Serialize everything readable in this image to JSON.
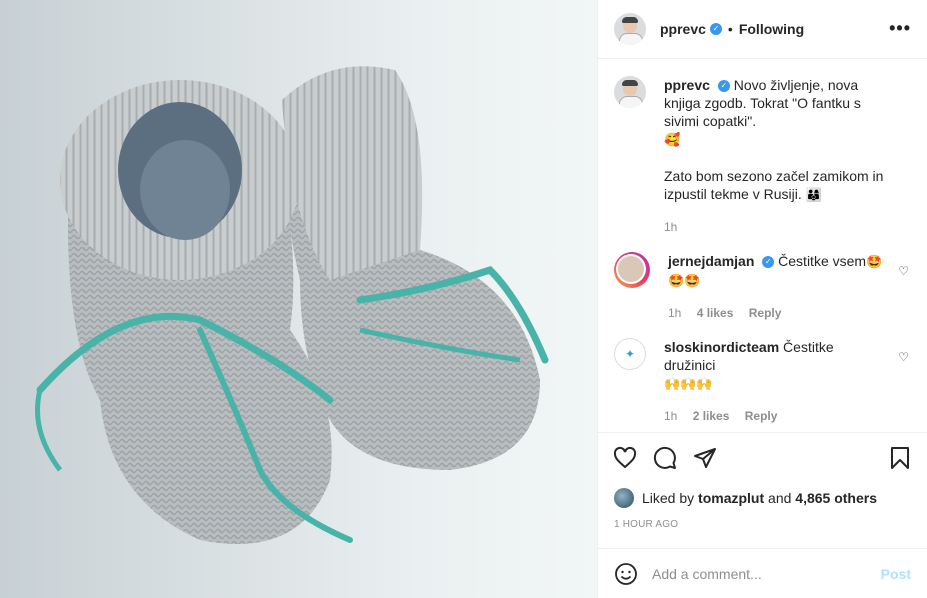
{
  "header": {
    "username": "pprevc",
    "separator": "•",
    "follow_state": "Following",
    "more_label": "•••"
  },
  "caption": {
    "username": "pprevc",
    "text_line1": "Novo življenje, nova knjiga zgodb. Tokrat \"O fantku s sivimi copatki\".",
    "emoji1": "🥰",
    "text_line2": "Zato bom sezono začel zamikom in izpustil tekme v Rusiji.",
    "emoji2": "👨‍👩‍👦",
    "time": "1h"
  },
  "comments": [
    {
      "username": "jernejdamjan",
      "text": "Čestitke vsem",
      "emoji": "🤩",
      "emoji_line2": "🤩🤩",
      "time": "1h",
      "likes": "4 likes",
      "reply": "Reply"
    },
    {
      "username": "sloskinordicteam",
      "text": "Čestitke družinici",
      "emoji_line2": "🙌🙌🙌",
      "time": "1h",
      "likes": "2 likes",
      "reply": "Reply"
    }
  ],
  "likes": {
    "prefix": "Liked by",
    "user": "tomazplut",
    "conj": "and",
    "others": "4,865 others"
  },
  "timestamp": "1 HOUR AGO",
  "add_comment": {
    "placeholder": "Add a comment...",
    "post_label": "Post"
  },
  "icons": [
    "heart-icon",
    "comment-icon",
    "share-icon",
    "bookmark-icon",
    "more-icon",
    "smile-icon",
    "verified-icon"
  ]
}
